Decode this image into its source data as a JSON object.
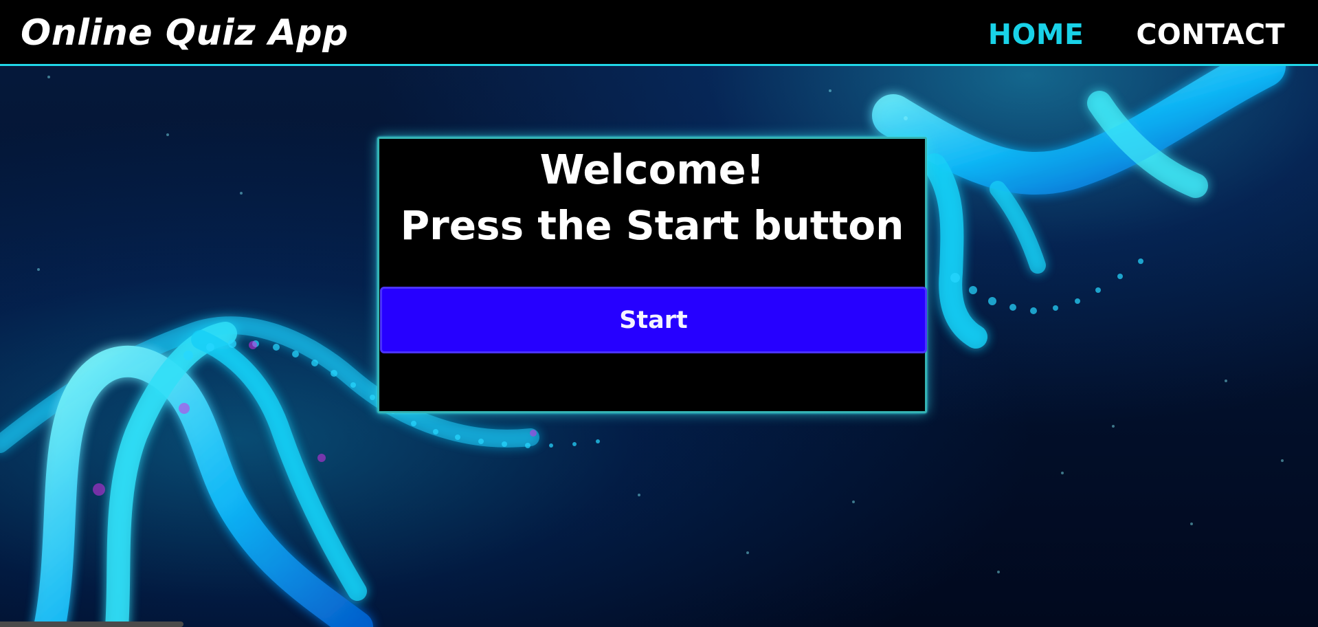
{
  "app": {
    "title": "Online Quiz App"
  },
  "navigation": {
    "links": [
      {
        "label": "HOME",
        "active": true
      },
      {
        "label": "CONTACT",
        "active": false
      }
    ]
  },
  "quiz_card": {
    "title": "Welcome!",
    "subtitle": "Press the Start button",
    "start_label": "Start"
  },
  "icons": {
    "background": "dna-helix-icon"
  },
  "colors": {
    "navbar": "#000000",
    "accent_cyan": "#19d2e8",
    "start_button": "#2600ff",
    "card_background": "#000000"
  }
}
